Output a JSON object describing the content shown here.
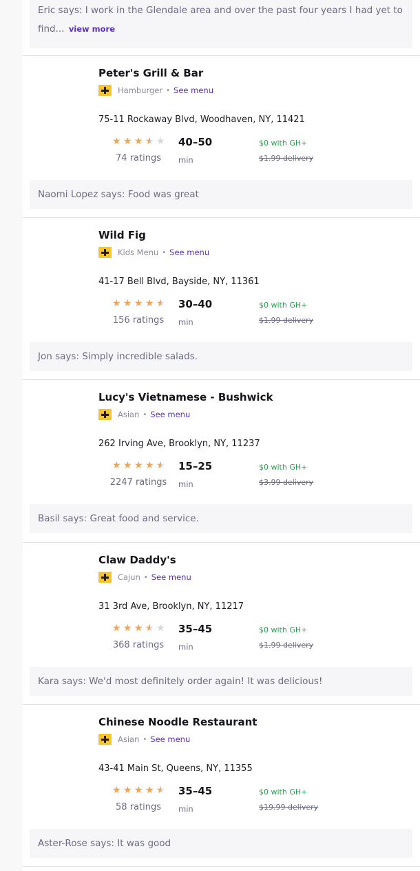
{
  "top_review": {
    "text": "Eric says: I work in the Glendale area and over the past four years I had yet to find...",
    "view_more": "view more"
  },
  "restaurants": [
    {
      "name": "Peter's Grill & Bar",
      "cuisine": "Hamburger",
      "see_menu": "See menu",
      "address": "75-11 Rockaway Blvd, Woodhaven, NY, 11421",
      "rating_stars": 3.5,
      "ratings_text": "74 ratings",
      "eta": "40–50",
      "eta_unit": "min",
      "gh_text": "$0 with GH+",
      "delivery_fee": "$1.99 delivery",
      "review": "Naomi Lopez says: Food was great"
    },
    {
      "name": "Wild Fig",
      "cuisine": "Kids Menu",
      "see_menu": "See menu",
      "address": "41-17 Bell Blvd, Bayside, NY, 11361",
      "rating_stars": 4.5,
      "ratings_text": "156 ratings",
      "eta": "30–40",
      "eta_unit": "min",
      "gh_text": "$0 with GH+",
      "delivery_fee": "$1.99 delivery",
      "review": "Jon says: Simply incredible salads."
    },
    {
      "name": "Lucy's Vietnamese - Bushwick",
      "cuisine": "Asian",
      "see_menu": "See menu",
      "address": "262 Irving Ave, Brooklyn, NY, 11237",
      "rating_stars": 4.5,
      "ratings_text": "2247 ratings",
      "eta": "15–25",
      "eta_unit": "min",
      "gh_text": "$0 with GH+",
      "delivery_fee": "$3.99 delivery",
      "review": "Basil says: Great food and service."
    },
    {
      "name": "Claw Daddy's",
      "cuisine": "Cajun",
      "see_menu": "See menu",
      "address": "31 3rd Ave, Brooklyn, NY, 11217",
      "rating_stars": 3.5,
      "ratings_text": "368 ratings",
      "eta": "35–45",
      "eta_unit": "min",
      "gh_text": "$0 with GH+",
      "delivery_fee": "$1.99 delivery",
      "review": "Kara says: We'd most definitely order again! It was delicious!"
    },
    {
      "name": "Chinese Noodle Restaurant",
      "cuisine": "Asian",
      "see_menu": "See menu",
      "address": "43-41 Main St, Queens, NY, 11355",
      "rating_stars": 4.5,
      "ratings_text": "58 ratings",
      "eta": "35–45",
      "eta_unit": "min",
      "gh_text": "$0 with GH+",
      "delivery_fee": "$19.99 delivery",
      "review": "Aster-Rose says: It was good"
    }
  ],
  "icons": {
    "badge": "grubhub-plus-badge-icon",
    "star": "star-icon"
  },
  "colors": {
    "accent": "#5a2fc2",
    "star": "#f4a552",
    "star_empty": "#d6d6dc",
    "badge": "#f6c42b",
    "gh_green": "#1fa34e"
  }
}
